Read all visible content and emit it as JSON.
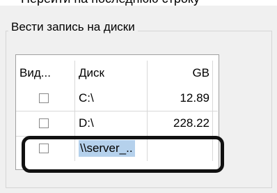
{
  "top_text": "Перейти на последнюю строку",
  "groupbox": {
    "title": "Вести запись на диски"
  },
  "table": {
    "headers": {
      "visible": "Вид...",
      "disk": "Диск",
      "gb": "GB"
    },
    "rows": [
      {
        "checked": false,
        "disk": "C:\\",
        "gb": "12.89"
      },
      {
        "checked": false,
        "disk": "D:\\",
        "gb": "228.22"
      },
      {
        "checked": false,
        "disk": "\\\\server_..",
        "gb": ""
      }
    ]
  },
  "colors": {
    "selection": "#b5d1ec",
    "highlight_border": "#111111"
  }
}
